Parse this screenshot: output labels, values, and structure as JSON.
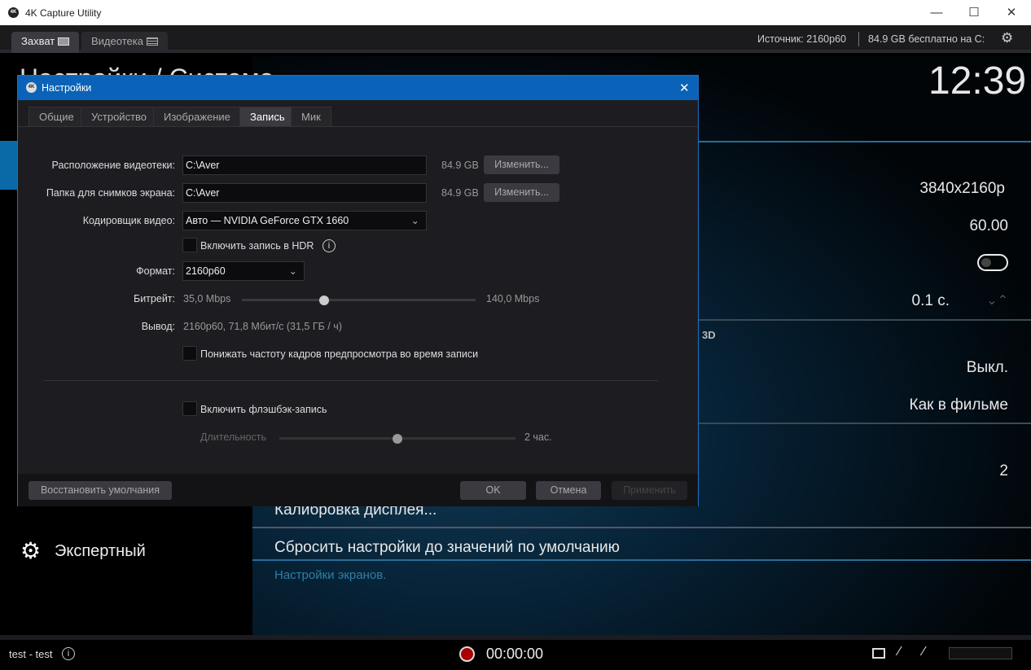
{
  "window": {
    "title": "4K Capture Utility",
    "logo": "4K",
    "minimize": "—",
    "maximize": "☐",
    "close": "✕"
  },
  "topbar": {
    "tabs": [
      {
        "label": "Захват",
        "active": true
      },
      {
        "label": "Видеотека",
        "active": false
      }
    ],
    "source": "Источник: 2160p60",
    "free_space": "84.9 GB бесплатно на C:"
  },
  "page": {
    "title": "Настройки / Система",
    "clock": "12:39"
  },
  "settings_panel": {
    "resolution": "3840x2160p",
    "framerate": "60.00",
    "toggle_on": false,
    "delay": "0.1 с.",
    "section_3d": "3D",
    "mode_3d": "Выкл.",
    "mode_3d_format": "Как в фильме",
    "count": "2",
    "calibration": "Калибровка дисплея...",
    "reset": "Сбросить настройки до значений по умолчанию",
    "hint": "Настройки экранов."
  },
  "sidebar": {
    "expert": "Экспертный"
  },
  "dialog": {
    "title": "Настройки",
    "logo": "4K",
    "close": "✕",
    "tabs": [
      {
        "label": "Общие"
      },
      {
        "label": "Устройство"
      },
      {
        "label": "Изображение"
      },
      {
        "label": "Запись",
        "active": true
      },
      {
        "label": "Мик"
      }
    ],
    "library_label": "Расположение видеотеки:",
    "library_path": "C:\\Aver",
    "library_free": "84.9 GB",
    "change": "Изменить...",
    "screenshot_label": "Папка для снимков экрана:",
    "screenshot_path": "C:\\Aver",
    "screenshot_free": "84.9 GB",
    "encoder_label": "Кодировщик видео:",
    "encoder_value": "Авто — NVIDIA GeForce GTX 1660",
    "hdr_label": "Включить запись в HDR",
    "hdr_checked": false,
    "format_label": "Формат:",
    "format_value": "2160p60",
    "bitrate_label": "Битрейт:",
    "bitrate_min": "35,0 Mbps",
    "bitrate_max": "140,0 Mbps",
    "bitrate_value": 71.8,
    "output_label": "Вывод:",
    "output_value": "2160p60, 71,8 Мбит/с (31,5 ГБ / ч)",
    "lower_fps_label": "Понижать частоту кадров предпросмотра во время записи",
    "lower_fps_checked": false,
    "flashback_label": "Включить флэшбэк-запись",
    "flashback_checked": false,
    "duration_label": "Длительность",
    "duration_value": "2 час.",
    "duration_fraction": 0.5,
    "restore": "Восстановить умолчания",
    "ok": "OK",
    "cancel": "Отмена",
    "apply": "Применить"
  },
  "statusbar": {
    "profile": "test - test",
    "timer": "00:00:00"
  }
}
